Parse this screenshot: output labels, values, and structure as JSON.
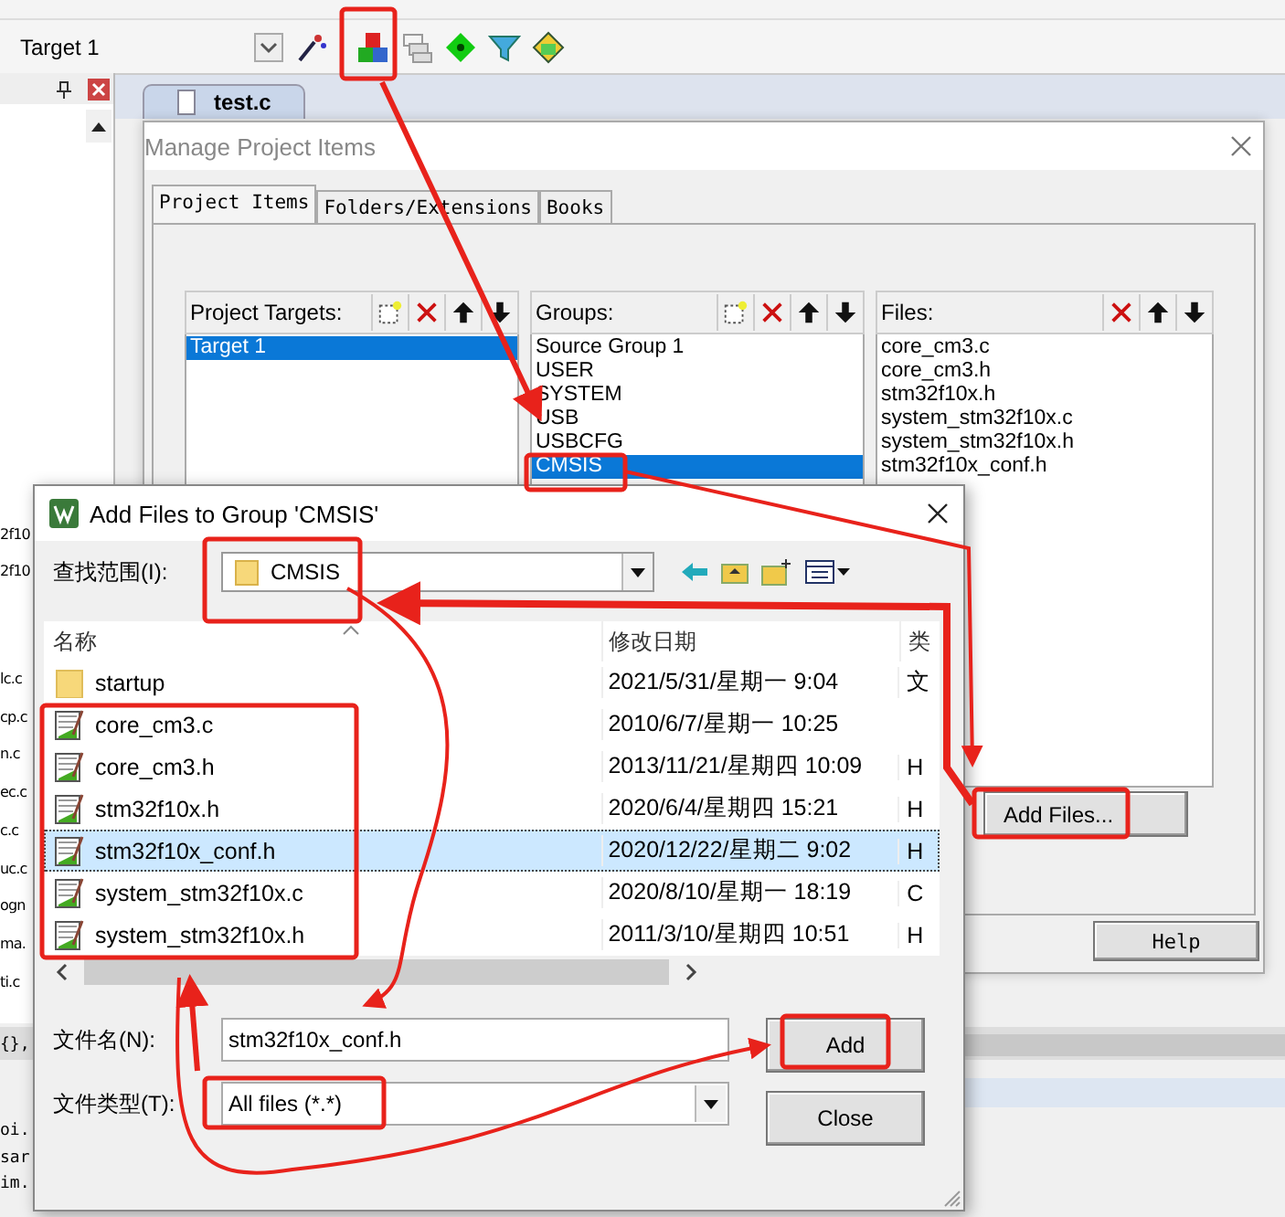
{
  "toolbar": {
    "target": "Target 1"
  },
  "side_panel": {
    "fragments_top": [
      "2f10",
      "2f10"
    ],
    "fragments": [
      "lc.c",
      "cp.c",
      "n.c",
      "ec.c",
      "c.c",
      "uc.c",
      "ogn",
      "ma.",
      "ti.c"
    ]
  },
  "editor": {
    "tab": "test.c",
    "bottom_fragments": [
      "{},",
      "oi.",
      "sar",
      "im."
    ]
  },
  "manage_dialog": {
    "title": "Manage Project Items",
    "tabs": [
      {
        "label": "Project Items",
        "selected": true
      },
      {
        "label": "Folders/Extensions",
        "selected": false
      },
      {
        "label": "Books",
        "selected": false
      }
    ],
    "targets": {
      "label": "Project Targets:",
      "items": [
        {
          "text": "Target 1",
          "selected": true
        }
      ]
    },
    "groups": {
      "label": "Groups:",
      "items": [
        {
          "text": "Source Group 1",
          "selected": false
        },
        {
          "text": "USER",
          "selected": false
        },
        {
          "text": "SYSTEM",
          "selected": false
        },
        {
          "text": "USB",
          "selected": false
        },
        {
          "text": "USBCFG",
          "selected": false
        },
        {
          "text": "CMSIS",
          "selected": true
        }
      ]
    },
    "files": {
      "label": "Files:",
      "items": [
        {
          "text": "core_cm3.c",
          "selected": false
        },
        {
          "text": "core_cm3.h",
          "selected": false
        },
        {
          "text": "stm32f10x.h",
          "selected": false
        },
        {
          "text": "system_stm32f10x.c",
          "selected": false
        },
        {
          "text": "system_stm32f10x.h",
          "selected": false
        },
        {
          "text": "stm32f10x_conf.h",
          "selected": false
        }
      ]
    },
    "add_files_button": "Add Files...",
    "help_button": "Help"
  },
  "add_dialog": {
    "title": "Add Files to Group 'CMSIS'",
    "look_in_label": "查找范围(I):",
    "look_in": "CMSIS",
    "columns": [
      "名称",
      "修改日期",
      "类"
    ],
    "rows": [
      {
        "name": "startup",
        "kind": "folder",
        "date": "2021/5/31/星期一 9:04",
        "type": "文",
        "selected": false
      },
      {
        "name": "core_cm3.c",
        "kind": "file",
        "date": "2010/6/7/星期一 10:25",
        "selected": false
      },
      {
        "name": "core_cm3.h",
        "kind": "file",
        "date": "2013/11/21/星期四 10:09",
        "type": "H",
        "selected": false
      },
      {
        "name": "stm32f10x.h",
        "kind": "file",
        "date": "2020/6/4/星期四 15:21",
        "type": "H",
        "selected": false
      },
      {
        "name": "stm32f10x_conf.h",
        "kind": "file",
        "date": "2020/12/22/星期二 9:02",
        "type": "H",
        "selected": true
      },
      {
        "name": "system_stm32f10x.c",
        "kind": "file",
        "date": "2020/8/10/星期一 18:19",
        "type": "C",
        "selected": false
      },
      {
        "name": "system_stm32f10x.h",
        "kind": "file",
        "date": "2011/3/10/星期四 10:51",
        "type": "H",
        "selected": false
      }
    ],
    "file_name_label": "文件名(N):",
    "file_name": "stm32f10x_conf.h",
    "file_type_label": "文件类型(T):",
    "file_type": "All files (*.*)",
    "add_button": "Add",
    "close_button": "Close"
  }
}
